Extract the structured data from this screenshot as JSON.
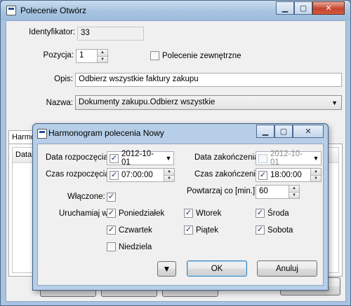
{
  "main_window": {
    "title": "Polecenie Otwórz",
    "caption": {
      "minimize": "▁",
      "maximize": "▢",
      "close": "✕"
    },
    "identyfikator": {
      "label": "Identyfikator:",
      "value": "33"
    },
    "pozycja": {
      "label": "Pozycja:",
      "value": "1"
    },
    "zewnetrzne": {
      "label": "Polecenie zewnętrzne",
      "checked": false
    },
    "opis": {
      "label": "Opis:",
      "value": "Odbierz wszystkie faktury zakupu"
    },
    "nazwa": {
      "label": "Nazwa:",
      "value": "Dokumenty zakupu.Odbierz wszystkie"
    },
    "tab_label": "Harmon",
    "grid_header": "Data r"
  },
  "dialog": {
    "title": "Harmonogram polecenia Nowy",
    "caption": {
      "minimize": "▁",
      "maximize": "▢",
      "close": "✕"
    },
    "data_rozpoczecia": {
      "label": "Data rozpoczęcia:",
      "value": "2012-10-01",
      "checked": true
    },
    "data_zakonczenia": {
      "label": "Data zakończenia:",
      "value": "2012-10-01",
      "checked": false
    },
    "czas_rozpoczecia": {
      "label": "Czas rozpoczęcia:",
      "value": "07:00:00",
      "checked": true
    },
    "czas_zakonczenia": {
      "label": "Czas zakończenia:",
      "value": "18:00:00",
      "checked": true
    },
    "wlaczone": {
      "label": "Włączone:",
      "checked": true
    },
    "powtarzaj": {
      "label": "Powtarzaj co [min.]:",
      "value": "60"
    },
    "uruchamiaj_label": "Uruchamiaj w:",
    "days": {
      "poniedzialek": "Poniedziałek",
      "wtorek": "Wtorek",
      "sroda": "Środa",
      "czwartek": "Czwartek",
      "piatek": "Piątek",
      "sobota": "Sobota",
      "niedziela": "Niedziela"
    },
    "ok_label": "OK",
    "anuluj_label": "Anuluj",
    "check_glyph": "✓",
    "dropdown_glyph": "▼",
    "spin_up": "▲",
    "spin_down": "▼"
  }
}
